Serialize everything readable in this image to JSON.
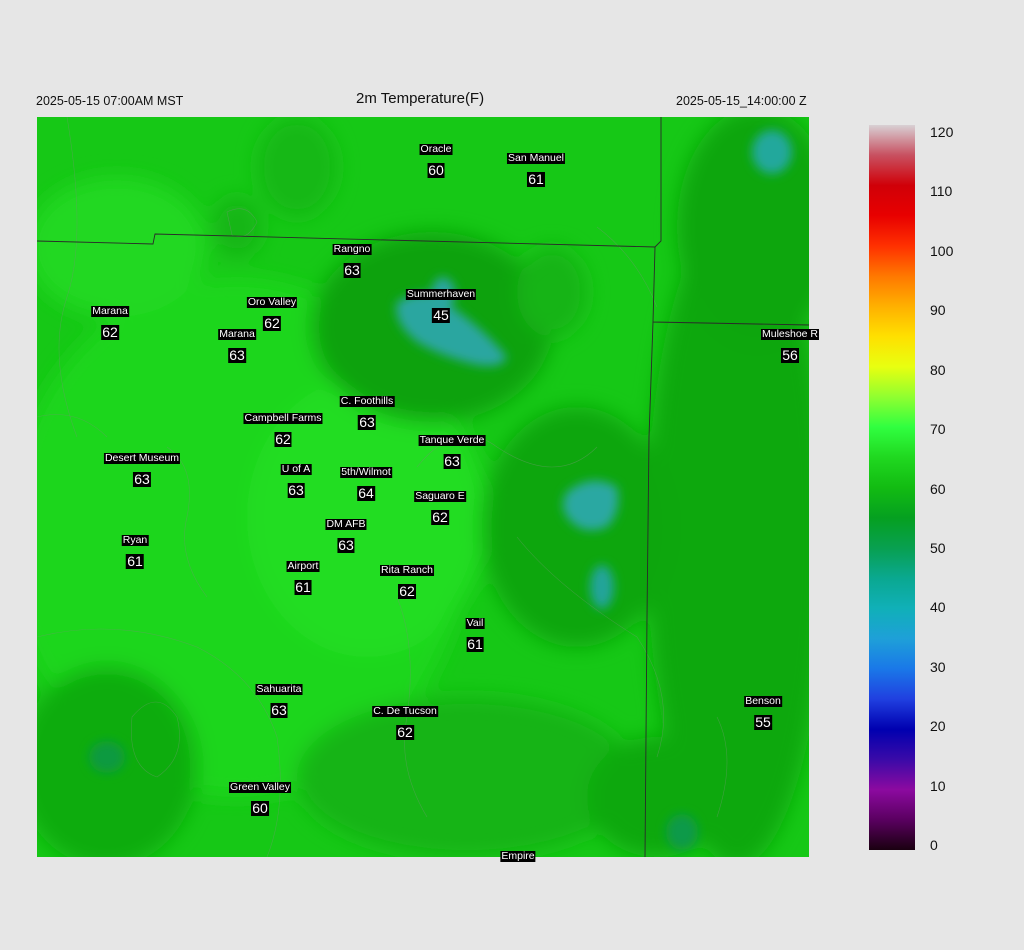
{
  "header": {
    "valid_local": "2025-05-15 07:00AM MST",
    "title": "2m Temperature(F)",
    "valid_utc": "2025-05-15_14:00:00 Z"
  },
  "stations": [
    {
      "id": "oracle",
      "name": "Oracle",
      "temp": "60"
    },
    {
      "id": "san-manuel",
      "name": "San Manuel",
      "temp": "61"
    },
    {
      "id": "rangno",
      "name": "Rangno",
      "temp": "63"
    },
    {
      "id": "summerhaven",
      "name": "Summerhaven",
      "temp": "45"
    },
    {
      "id": "marana-west",
      "name": "Marana",
      "temp": "62"
    },
    {
      "id": "oro-valley",
      "name": "Oro Valley",
      "temp": "62"
    },
    {
      "id": "marana",
      "name": "Marana",
      "temp": "63"
    },
    {
      "id": "muleshoe",
      "name": "Muleshoe R",
      "temp": "56"
    },
    {
      "id": "c-foothills",
      "name": "C. Foothills",
      "temp": "63"
    },
    {
      "id": "campbell-farms",
      "name": "Campbell Farms",
      "temp": "62"
    },
    {
      "id": "tanque-verde",
      "name": "Tanque Verde",
      "temp": "63"
    },
    {
      "id": "desert-museum",
      "name": "Desert Museum",
      "temp": "63"
    },
    {
      "id": "u-of-a",
      "name": "U of A",
      "temp": "63"
    },
    {
      "id": "5th-wilmot",
      "name": "5th/Wilmot",
      "temp": "64"
    },
    {
      "id": "saguaro-e",
      "name": "Saguaro E",
      "temp": "62"
    },
    {
      "id": "dm-afb",
      "name": "DM AFB",
      "temp": "63"
    },
    {
      "id": "ryan",
      "name": "Ryan",
      "temp": "61"
    },
    {
      "id": "airport",
      "name": "Airport",
      "temp": "61"
    },
    {
      "id": "rita-ranch",
      "name": "Rita Ranch",
      "temp": "62"
    },
    {
      "id": "vail",
      "name": "Vail",
      "temp": "61"
    },
    {
      "id": "sahuarita",
      "name": "Sahuarita",
      "temp": "63"
    },
    {
      "id": "c-de-tucson",
      "name": "C. De Tucson",
      "temp": "62"
    },
    {
      "id": "benson",
      "name": "Benson",
      "temp": "55"
    },
    {
      "id": "green-valley",
      "name": "Green Valley",
      "temp": "60"
    },
    {
      "id": "empire",
      "name": "Empire",
      "temp": ""
    }
  ],
  "colorbar": {
    "min": 0,
    "max": 120,
    "ticks": [
      "120",
      "110",
      "100",
      "90",
      "80",
      "70",
      "60",
      "50",
      "40",
      "30",
      "20",
      "10",
      "0"
    ],
    "stops": [
      {
        "value": 0,
        "color": "#1a0010"
      },
      {
        "value": 5,
        "color": "#5a0060"
      },
      {
        "value": 10,
        "color": "#8c0aa0"
      },
      {
        "value": 15,
        "color": "#3a0aa8"
      },
      {
        "value": 20,
        "color": "#0000b0"
      },
      {
        "value": 25,
        "color": "#2040e0"
      },
      {
        "value": 30,
        "color": "#1a78e8"
      },
      {
        "value": 35,
        "color": "#1ea0d8"
      },
      {
        "value": 40,
        "color": "#10b0b8"
      },
      {
        "value": 45,
        "color": "#0aa890"
      },
      {
        "value": 50,
        "color": "#08a050"
      },
      {
        "value": 55,
        "color": "#05a020"
      },
      {
        "value": 60,
        "color": "#12bc12"
      },
      {
        "value": 65,
        "color": "#20d820"
      },
      {
        "value": 70,
        "color": "#30ff40"
      },
      {
        "value": 75,
        "color": "#90ff30"
      },
      {
        "value": 80,
        "color": "#e8ff10"
      },
      {
        "value": 85,
        "color": "#ffe000"
      },
      {
        "value": 90,
        "color": "#ffb000"
      },
      {
        "value": 95,
        "color": "#ff7800"
      },
      {
        "value": 100,
        "color": "#ff3000"
      },
      {
        "value": 105,
        "color": "#e80000"
      },
      {
        "value": 110,
        "color": "#d00008"
      },
      {
        "value": 115,
        "color": "#c85060"
      },
      {
        "value": 120,
        "color": "#d8d0d4"
      }
    ]
  },
  "colors": {
    "map_base": "#16c816",
    "cold_spot": "#2aa6a0",
    "boundary": "#333333",
    "background": "#e6e6e6"
  }
}
